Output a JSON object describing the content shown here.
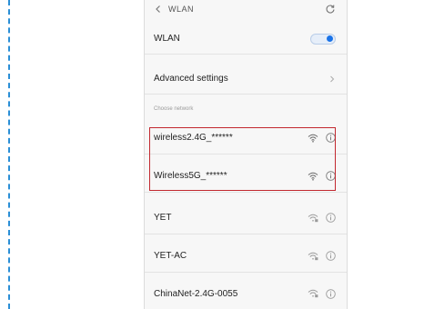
{
  "header": {
    "title": "WLAN"
  },
  "wlan_toggle": {
    "label": "WLAN",
    "state": "on"
  },
  "advanced": {
    "label": "Advanced settings"
  },
  "section": {
    "label": "Choose network"
  },
  "networks": [
    {
      "name": "wireless2.4G_******",
      "signal_icon": "wifi-icon",
      "info_icon": "info-icon"
    },
    {
      "name": "Wireless5G_******",
      "signal_icon": "wifi-icon",
      "info_icon": "info-icon"
    },
    {
      "name": "YET",
      "signal_icon": "wifi-locked-icon",
      "info_icon": "info-icon"
    },
    {
      "name": "YET-AC",
      "signal_icon": "wifi-locked-icon",
      "info_icon": "info-icon"
    },
    {
      "name": "ChinaNet-2.4G-0055",
      "signal_icon": "wifi-locked-icon",
      "info_icon": "info-icon"
    }
  ],
  "colors": {
    "accent": "#1a73e8",
    "highlight": "#c2282f",
    "guide": "#2b8fd6"
  }
}
